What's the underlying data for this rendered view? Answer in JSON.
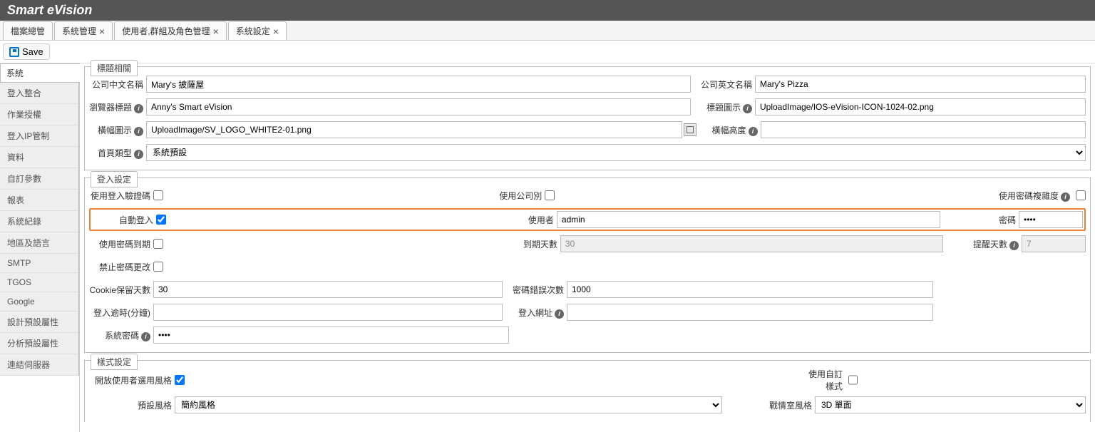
{
  "app_title": "Smart eVision",
  "tabs": [
    {
      "label": "檔案總管",
      "closable": false
    },
    {
      "label": "系統管理",
      "closable": true
    },
    {
      "label": "使用者,群組及角色管理",
      "closable": true
    },
    {
      "label": "系統設定",
      "closable": true
    }
  ],
  "toolbar": {
    "save_label": "Save"
  },
  "side_tab": "系統",
  "nav_items": [
    "登入整合",
    "作業授權",
    "登入IP管制",
    "資料",
    "自訂參數",
    "報表",
    "系統紀錄",
    "地區及語言",
    "SMTP",
    "TGOS",
    "Google",
    "設計預設屬性",
    "分析預設屬性",
    "連結伺服器"
  ],
  "section_title_header": "標題相關",
  "section_login": "登入設定",
  "section_style": "樣式設定",
  "labels": {
    "company_cn": "公司中文名稱",
    "company_en": "公司英文名稱",
    "browser_title": "瀏覽器標題",
    "title_icon": "標題圖示",
    "banner_icon": "橫幅圖示",
    "banner_height": "橫幅高度",
    "home_type": "首頁類型",
    "use_captcha": "使用登入驗證碼",
    "use_company": "使用公司別",
    "use_pw_complex": "使用密碼複雜度",
    "auto_login": "自動登入",
    "user": "使用者",
    "password": "密碼",
    "use_pw_expire": "使用密碼到期",
    "expire_days": "到期天數",
    "remind_days": "提醒天數",
    "forbid_pw_change": "禁止密碼更改",
    "cookie_keep": "Cookie保留天數",
    "pw_error_count": "密碼錯誤次數",
    "login_timeout": "登入逾時(分鐘)",
    "login_url": "登入網址",
    "system_pw": "系統密碼",
    "open_user_style": "開放使用者選用風格",
    "use_custom_style": "使用自訂樣式",
    "default_style": "預設風格",
    "war_room_style": "戰情室風格"
  },
  "values": {
    "company_cn": "Mary's 披薩屋",
    "company_en": "Mary's Pizza",
    "browser_title": "Anny's Smart eVision",
    "title_icon": "UploadImage/IOS-eVision-ICON-1024-02.png",
    "banner_icon": "UploadImage/SV_LOGO_WHITE2-01.png",
    "banner_height": "",
    "home_type": "系統預設",
    "auto_login": true,
    "user": "admin",
    "password": "••••",
    "expire_days": "30",
    "remind_days": "7",
    "cookie_keep": "30",
    "pw_error_count": "1000",
    "login_timeout": "",
    "login_url": "",
    "system_pw": "••••",
    "open_user_style": true,
    "use_custom_style": false,
    "default_style": "簡約風格",
    "war_room_style": "3D 單面"
  }
}
